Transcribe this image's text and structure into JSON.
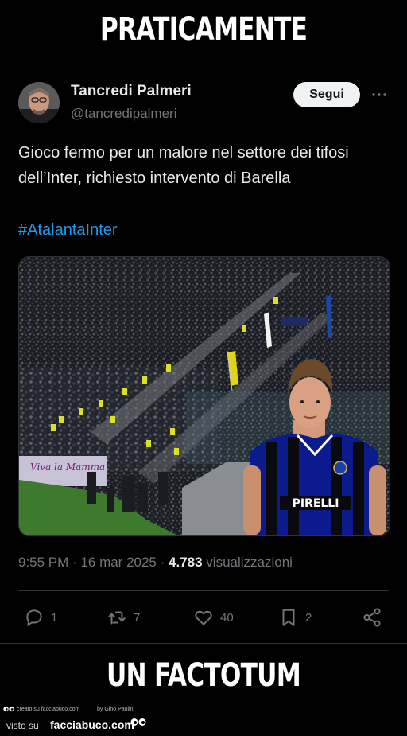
{
  "meme": {
    "top_text": "PRATICAMENTE",
    "bottom_text": "UN FACTOTUM"
  },
  "tweet": {
    "author_name": "Tancredi Palmeri",
    "author_handle": "@tancredipalmeri",
    "follow_label": "Segui",
    "text": "Gioco fermo per un malore nel settore dei tifosi dell’Inter, richiesto intervento di Barella",
    "hashtag": "#AtalantaInter",
    "time": "9:55 PM",
    "date": "16 mar 2025",
    "views_count": "4.783",
    "views_label": "visualizzazioni",
    "photo": {
      "banner_text": "Viva la Mamma",
      "jersey_sponsor": "PIRELLI"
    },
    "actions": {
      "replies": "1",
      "reposts": "7",
      "likes": "40",
      "bookmarks": "2"
    }
  },
  "watermark": {
    "created_on": "creato su facciabuco.com",
    "by": "by Gino Paolini",
    "seen_on": "visto su",
    "site": "facciabuco.com"
  },
  "colors": {
    "background": "#000000",
    "text_primary": "#e7e9ea",
    "text_secondary": "#71767b",
    "link": "#1d9bf0",
    "divider": "#2f3336"
  },
  "icons": [
    "more-icon",
    "reply-icon",
    "repost-icon",
    "like-icon",
    "bookmark-icon",
    "share-icon",
    "eyes-logo-icon"
  ]
}
